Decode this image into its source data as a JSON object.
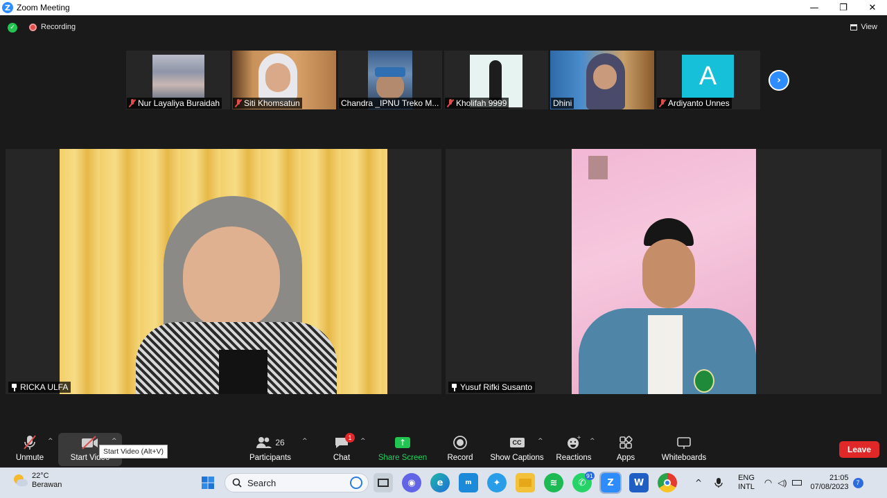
{
  "window": {
    "title": "Zoom Meeting",
    "controls": [
      "—",
      "❐",
      "✕"
    ]
  },
  "meeting_header": {
    "recording_label": "Recording",
    "view_label": "View"
  },
  "thumbnails": [
    {
      "name": "Nur Layaliya Buraidah",
      "muted": true
    },
    {
      "name": "Siti Khomsatun",
      "muted": true
    },
    {
      "name": "Chandra _IPNU Treko M...",
      "muted": false
    },
    {
      "name": "Kholifah 9999",
      "muted": true
    },
    {
      "name": "Dhini",
      "muted": false
    },
    {
      "name": "Ardiyanto Unnes",
      "muted": true,
      "avatar_letter": "A"
    }
  ],
  "main_tiles": [
    {
      "name": "RICKA ULFA"
    },
    {
      "name": "Yusuf Rifki Susanto"
    }
  ],
  "toolbar": {
    "unmute": "Unmute",
    "start_video": "Start Video",
    "tooltip": "Start Video (Alt+V)",
    "participants": "Participants",
    "participants_count": "26",
    "chat": "Chat",
    "chat_badge": "1",
    "share_screen": "Share Screen",
    "record": "Record",
    "show_captions": "Show Captions",
    "captions_icon_text": "CC",
    "reactions": "Reactions",
    "apps": "Apps",
    "whiteboards": "Whiteboards",
    "leave": "Leave"
  },
  "taskbar": {
    "weather_temp": "22°C",
    "weather_desc": "Berawan",
    "search_placeholder": "Search",
    "whatsapp_badge": "91",
    "language_top": "ENG",
    "language_bottom": "INTL",
    "time": "21:05",
    "date": "07/08/2023",
    "notification_count": "7"
  },
  "colors": {
    "zoom_blue": "#2d8cff",
    "share_green": "#23c552",
    "leave_red": "#e02828",
    "mute_red": "#e14c4c"
  }
}
